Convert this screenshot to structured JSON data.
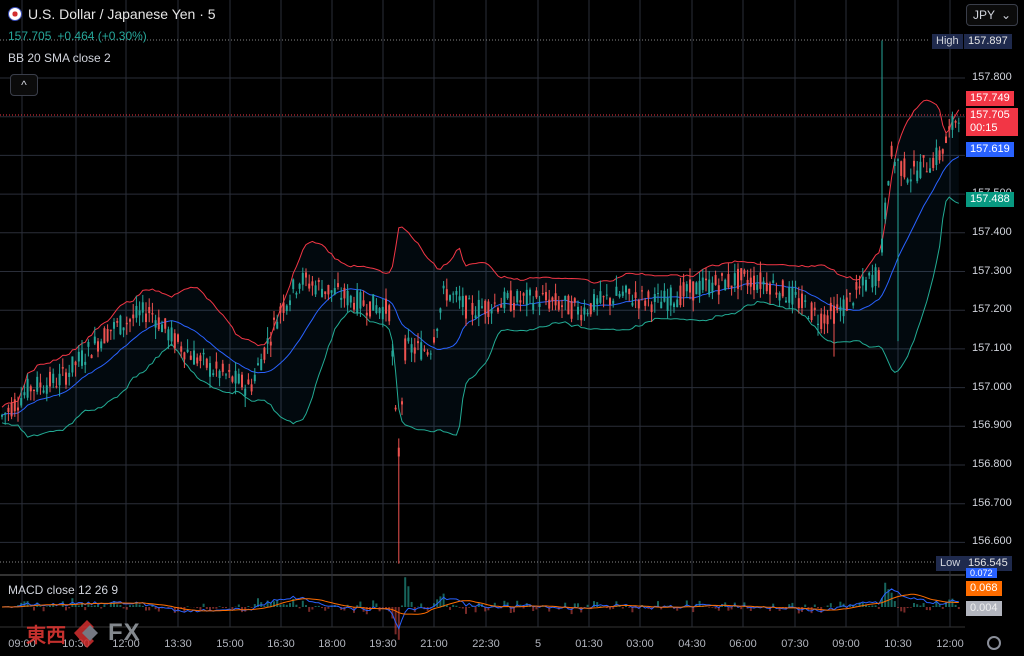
{
  "header": {
    "symbol": "U.S. Dollar / Japanese Yen · 5",
    "price": "157.705",
    "change": "+0.464 (+0.30%)"
  },
  "indicator": {
    "bb_label": "BB 20 SMA close 2",
    "macd_label": "MACD close 12 26 9"
  },
  "currency_selector": {
    "value": "JPY",
    "caret": "⌄"
  },
  "collapse_icon": "^",
  "y_axis": {
    "ticks": [
      "157.800",
      "157.700",
      "157.600",
      "157.500",
      "157.400",
      "157.300",
      "157.200",
      "157.100",
      "157.000",
      "156.900",
      "156.800",
      "156.700",
      "156.600"
    ]
  },
  "x_axis": {
    "ticks": [
      "09:00",
      "10:30",
      "12:00",
      "13:30",
      "15:00",
      "16:30",
      "18:00",
      "19:30",
      "21:00",
      "22:30",
      "5",
      "01:30",
      "03:00",
      "04:30",
      "06:00",
      "07:30",
      "09:00",
      "10:30",
      "12:00"
    ]
  },
  "price_tags": {
    "high_label": "High",
    "high_value": "157.897",
    "low_label": "Low",
    "low_value": "156.545",
    "upper_band": "157.749",
    "last_price": "157.705",
    "countdown": "00:15",
    "basis": "157.619",
    "lower_band": "157.488",
    "macd_a": "0.072",
    "macd_b": "0.068",
    "macd_c": "0.004"
  },
  "logo": {
    "kanji": "東西",
    "fx": "FX"
  },
  "colors": {
    "up": "#26a69a",
    "down": "#ef5350",
    "basis": "#2962ff",
    "upper": "#f23645",
    "lower": "#22ab94",
    "background": "#000000"
  },
  "chart_data": {
    "type": "candlestick",
    "y_range": [
      156.545,
      157.897
    ],
    "high": 157.897,
    "low": 156.545,
    "last": 157.705,
    "bands": {
      "upper": 157.749,
      "basis": 157.619,
      "lower": 157.488
    }
  }
}
